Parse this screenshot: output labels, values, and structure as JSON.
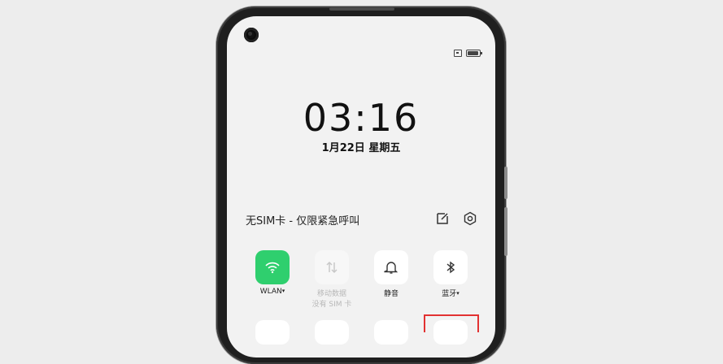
{
  "lock_screen": {
    "time": "03:16",
    "date": "1月22日  星期五"
  },
  "control_center": {
    "sim_status": "无SIM卡 - 仅限紧急呼叫",
    "tiles": [
      {
        "label": "WLAN",
        "caret": "▾",
        "sublabel": "",
        "icon": "wifi-icon",
        "active": true,
        "color": "#2fcf6e"
      },
      {
        "label": "移动数据",
        "caret": "",
        "sublabel": "没有 SIM 卡",
        "icon": "mobile-data-icon",
        "active": false
      },
      {
        "label": "静音",
        "caret": "",
        "sublabel": "",
        "icon": "bell-icon",
        "active": false
      },
      {
        "label": "蓝牙",
        "caret": "▾",
        "sublabel": "",
        "icon": "bluetooth-icon",
        "active": false
      }
    ],
    "highlight_color": "#e23232"
  }
}
